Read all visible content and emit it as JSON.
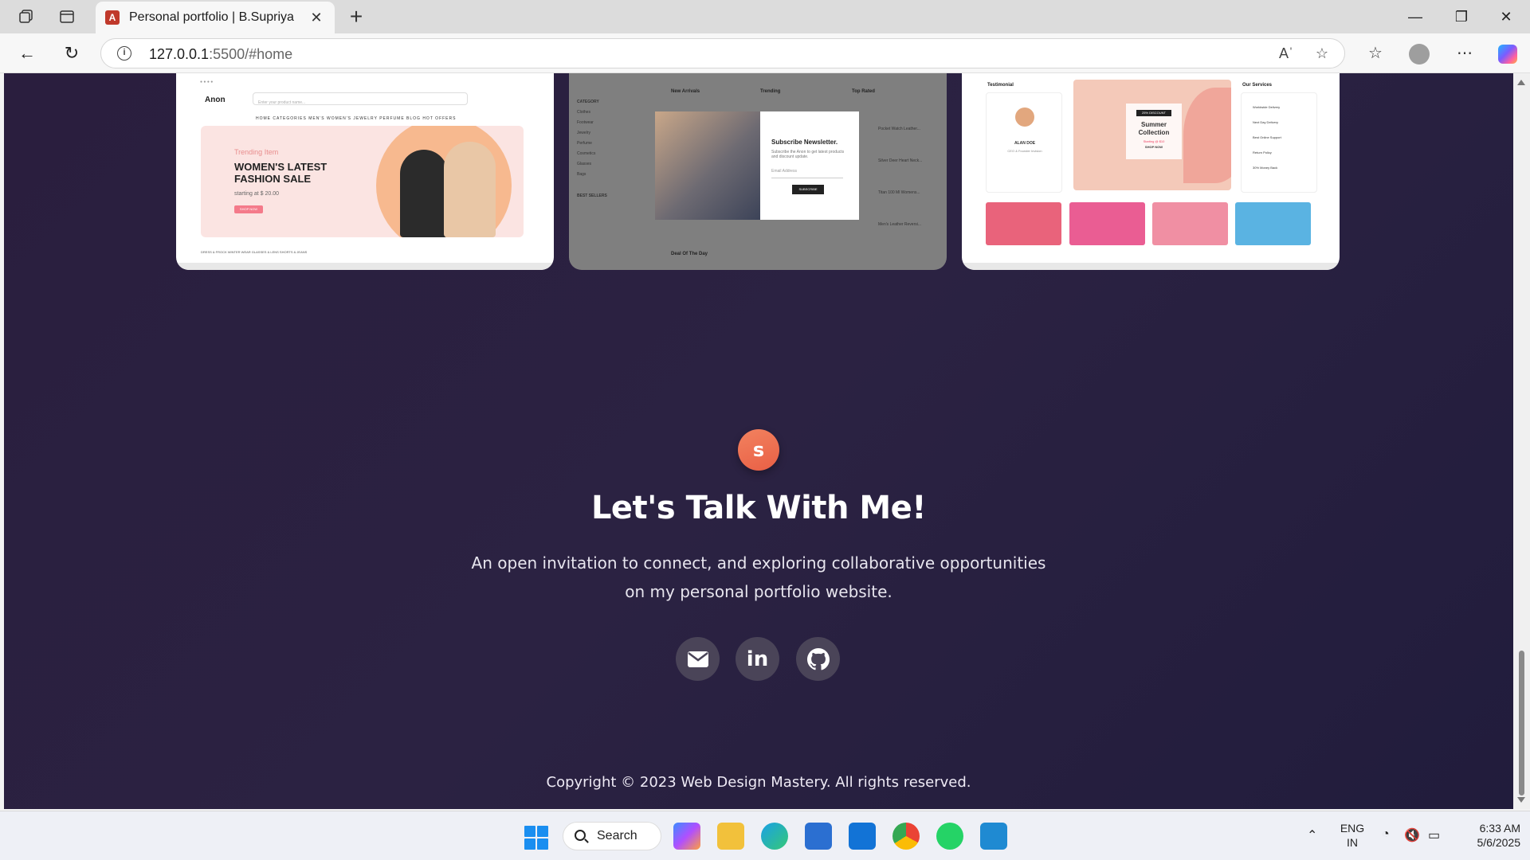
{
  "browser": {
    "tab_title": "Personal portfolio | B.Supriya",
    "tab_favicon_letter": "A",
    "url_host": "127.0.0.1",
    "url_rest": ":5500/#home",
    "new_tab": "+",
    "close_tab": "✕"
  },
  "page": {
    "logo_letter": "s",
    "heading": "Let's Talk With Me!",
    "description_line1": "An open invitation to connect, and exploring collaborative opportunities",
    "description_line2": "on my personal portfolio website.",
    "copyright": "Copyright © 2023 Web Design Mastery. All rights reserved.",
    "social": [
      {
        "name": "email",
        "icon": "mail-icon"
      },
      {
        "name": "linkedin",
        "icon": "linkedin-icon",
        "label": "in"
      },
      {
        "name": "github",
        "icon": "github-icon"
      }
    ]
  },
  "cards": {
    "card1": {
      "logo": "Anon",
      "search_placeholder": "Enter your product name...",
      "nav": "HOME   CATEGORIES   MEN'S   WOMEN'S   JEWELRY   PERFUME   BLOG   HOT OFFERS",
      "trending": "Trending Item",
      "headline1": "WOMEN'S LATEST",
      "headline2": "FASHION SALE",
      "starting": "starting at $ 20.00",
      "shop": "SHOP NOW",
      "categories": "DRESS & FROCK        WINTER WEAR        GLASSES & LENS        SHORTS & JEANS"
    },
    "card2": {
      "new_arrivals": "New Arrivals",
      "trending": "Trending",
      "top_rated": "Top Rated",
      "category": "CATEGORY",
      "side_items": [
        "Clothes",
        "Footwear",
        "Jewelry",
        "Perfume",
        "Cosmetics",
        "Glasses",
        "Bags"
      ],
      "best_sellers": "BEST SELLERS",
      "modal_title": "Subscribe Newsletter.",
      "modal_text": "Subscribe the Anon to get latest products and discount update.",
      "modal_input": "Email Address",
      "modal_button": "SUBSCRIBE",
      "rows": [
        "Pocket Watch Leather...",
        "Silver Deer Heart Neck...",
        "Titan 100 Ml Womens...",
        "Men's Leather Reversi..."
      ],
      "deal": "Deal Of The Day"
    },
    "card3": {
      "testimonial": "Testimonial",
      "person": "ALAN DOE",
      "role": "CEO & Founder Invision",
      "banner_badge": "25% DISCOUNT",
      "banner_title1": "Summer",
      "banner_title2": "Collection",
      "banner_start": "Starting @ $10",
      "banner_shop": "SHOP NOW",
      "services": "Our Services",
      "service_items": [
        "Worldwide Delivery",
        "Next Day Delivery",
        "Best Online Support",
        "Return Policy",
        "30% Money Back"
      ]
    }
  },
  "taskbar": {
    "search": "Search",
    "lang1": "ENG",
    "lang2": "IN",
    "time": "6:33 AM",
    "date": "5/6/2025"
  },
  "colors": {
    "page_bg": "#2b2242",
    "accent": "#ee6d4f",
    "social_bg": "#4a4458"
  }
}
